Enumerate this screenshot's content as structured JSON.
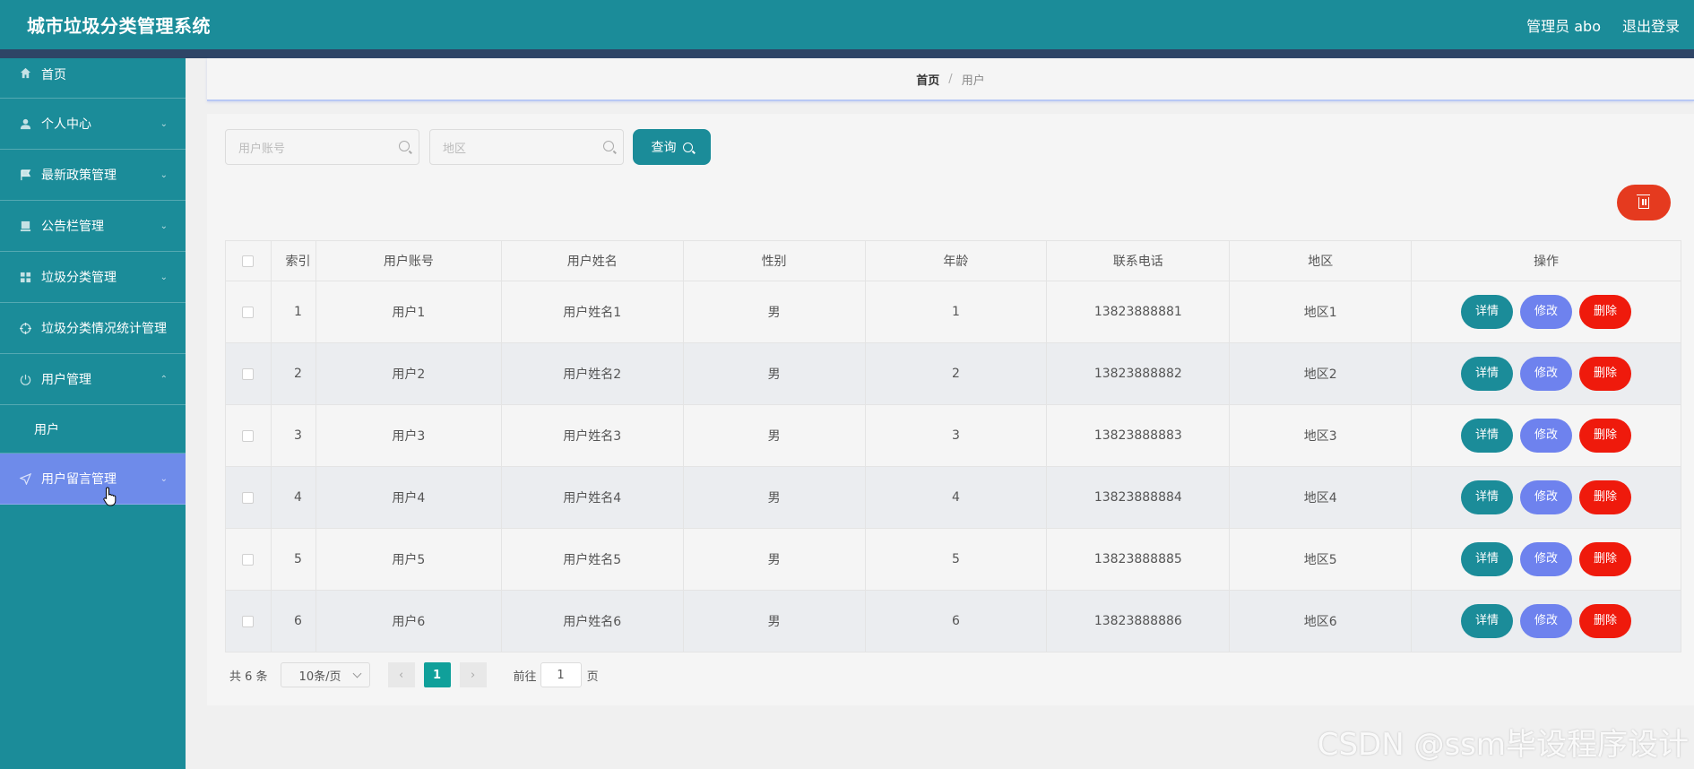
{
  "header": {
    "title": "城市垃圾分类管理系统",
    "admin": "管理员 abo",
    "logout": "退出登录"
  },
  "sidebar": {
    "items": [
      {
        "label": "首页",
        "icon": "home-icon"
      },
      {
        "label": "个人中心",
        "icon": "user-icon"
      },
      {
        "label": "最新政策管理",
        "icon": "flag-icon"
      },
      {
        "label": "公告栏管理",
        "icon": "board-icon"
      },
      {
        "label": "垃圾分类管理",
        "icon": "grid-icon"
      },
      {
        "label": "垃圾分类情况统计管理",
        "icon": "target-icon"
      },
      {
        "label": "用户管理",
        "icon": "power-icon"
      },
      {
        "label": "用户留言管理",
        "icon": "send-icon"
      }
    ],
    "sub_user": "用户"
  },
  "breadcrumb": {
    "home": "首页",
    "separator": "/",
    "current": "用户"
  },
  "search": {
    "account_placeholder": "用户账号",
    "region_placeholder": "地区",
    "query_label": "查询"
  },
  "table": {
    "headers": [
      "索引",
      "用户账号",
      "用户姓名",
      "性别",
      "年龄",
      "联系电话",
      "地区",
      "操作"
    ],
    "rows": [
      {
        "idx": "1",
        "account": "用户1",
        "name": "用户姓名1",
        "gender": "男",
        "age": "1",
        "phone": "13823888881",
        "region": "地区1"
      },
      {
        "idx": "2",
        "account": "用户2",
        "name": "用户姓名2",
        "gender": "男",
        "age": "2",
        "phone": "13823888882",
        "region": "地区2"
      },
      {
        "idx": "3",
        "account": "用户3",
        "name": "用户姓名3",
        "gender": "男",
        "age": "3",
        "phone": "13823888883",
        "region": "地区3"
      },
      {
        "idx": "4",
        "account": "用户4",
        "name": "用户姓名4",
        "gender": "男",
        "age": "4",
        "phone": "13823888884",
        "region": "地区4"
      },
      {
        "idx": "5",
        "account": "用户5",
        "name": "用户姓名5",
        "gender": "男",
        "age": "5",
        "phone": "13823888885",
        "region": "地区5"
      },
      {
        "idx": "6",
        "account": "用户6",
        "name": "用户姓名6",
        "gender": "男",
        "age": "6",
        "phone": "13823888886",
        "region": "地区6"
      }
    ],
    "actions": {
      "detail": "详情",
      "edit": "修改",
      "delete": "删除"
    }
  },
  "pager": {
    "total": "共 6 条",
    "page_size": "10条/页",
    "current_page": "1",
    "goto_label": "前往",
    "goto_value": "1",
    "page_suffix": "页"
  },
  "watermark": "CSDN @ssm毕设程序设计",
  "colors": {
    "primary": "#1b8c99",
    "active_menu": "#6e8bea",
    "edit": "#6e82ee",
    "danger": "#ef1a0c",
    "pager_active": "#10a09a"
  }
}
